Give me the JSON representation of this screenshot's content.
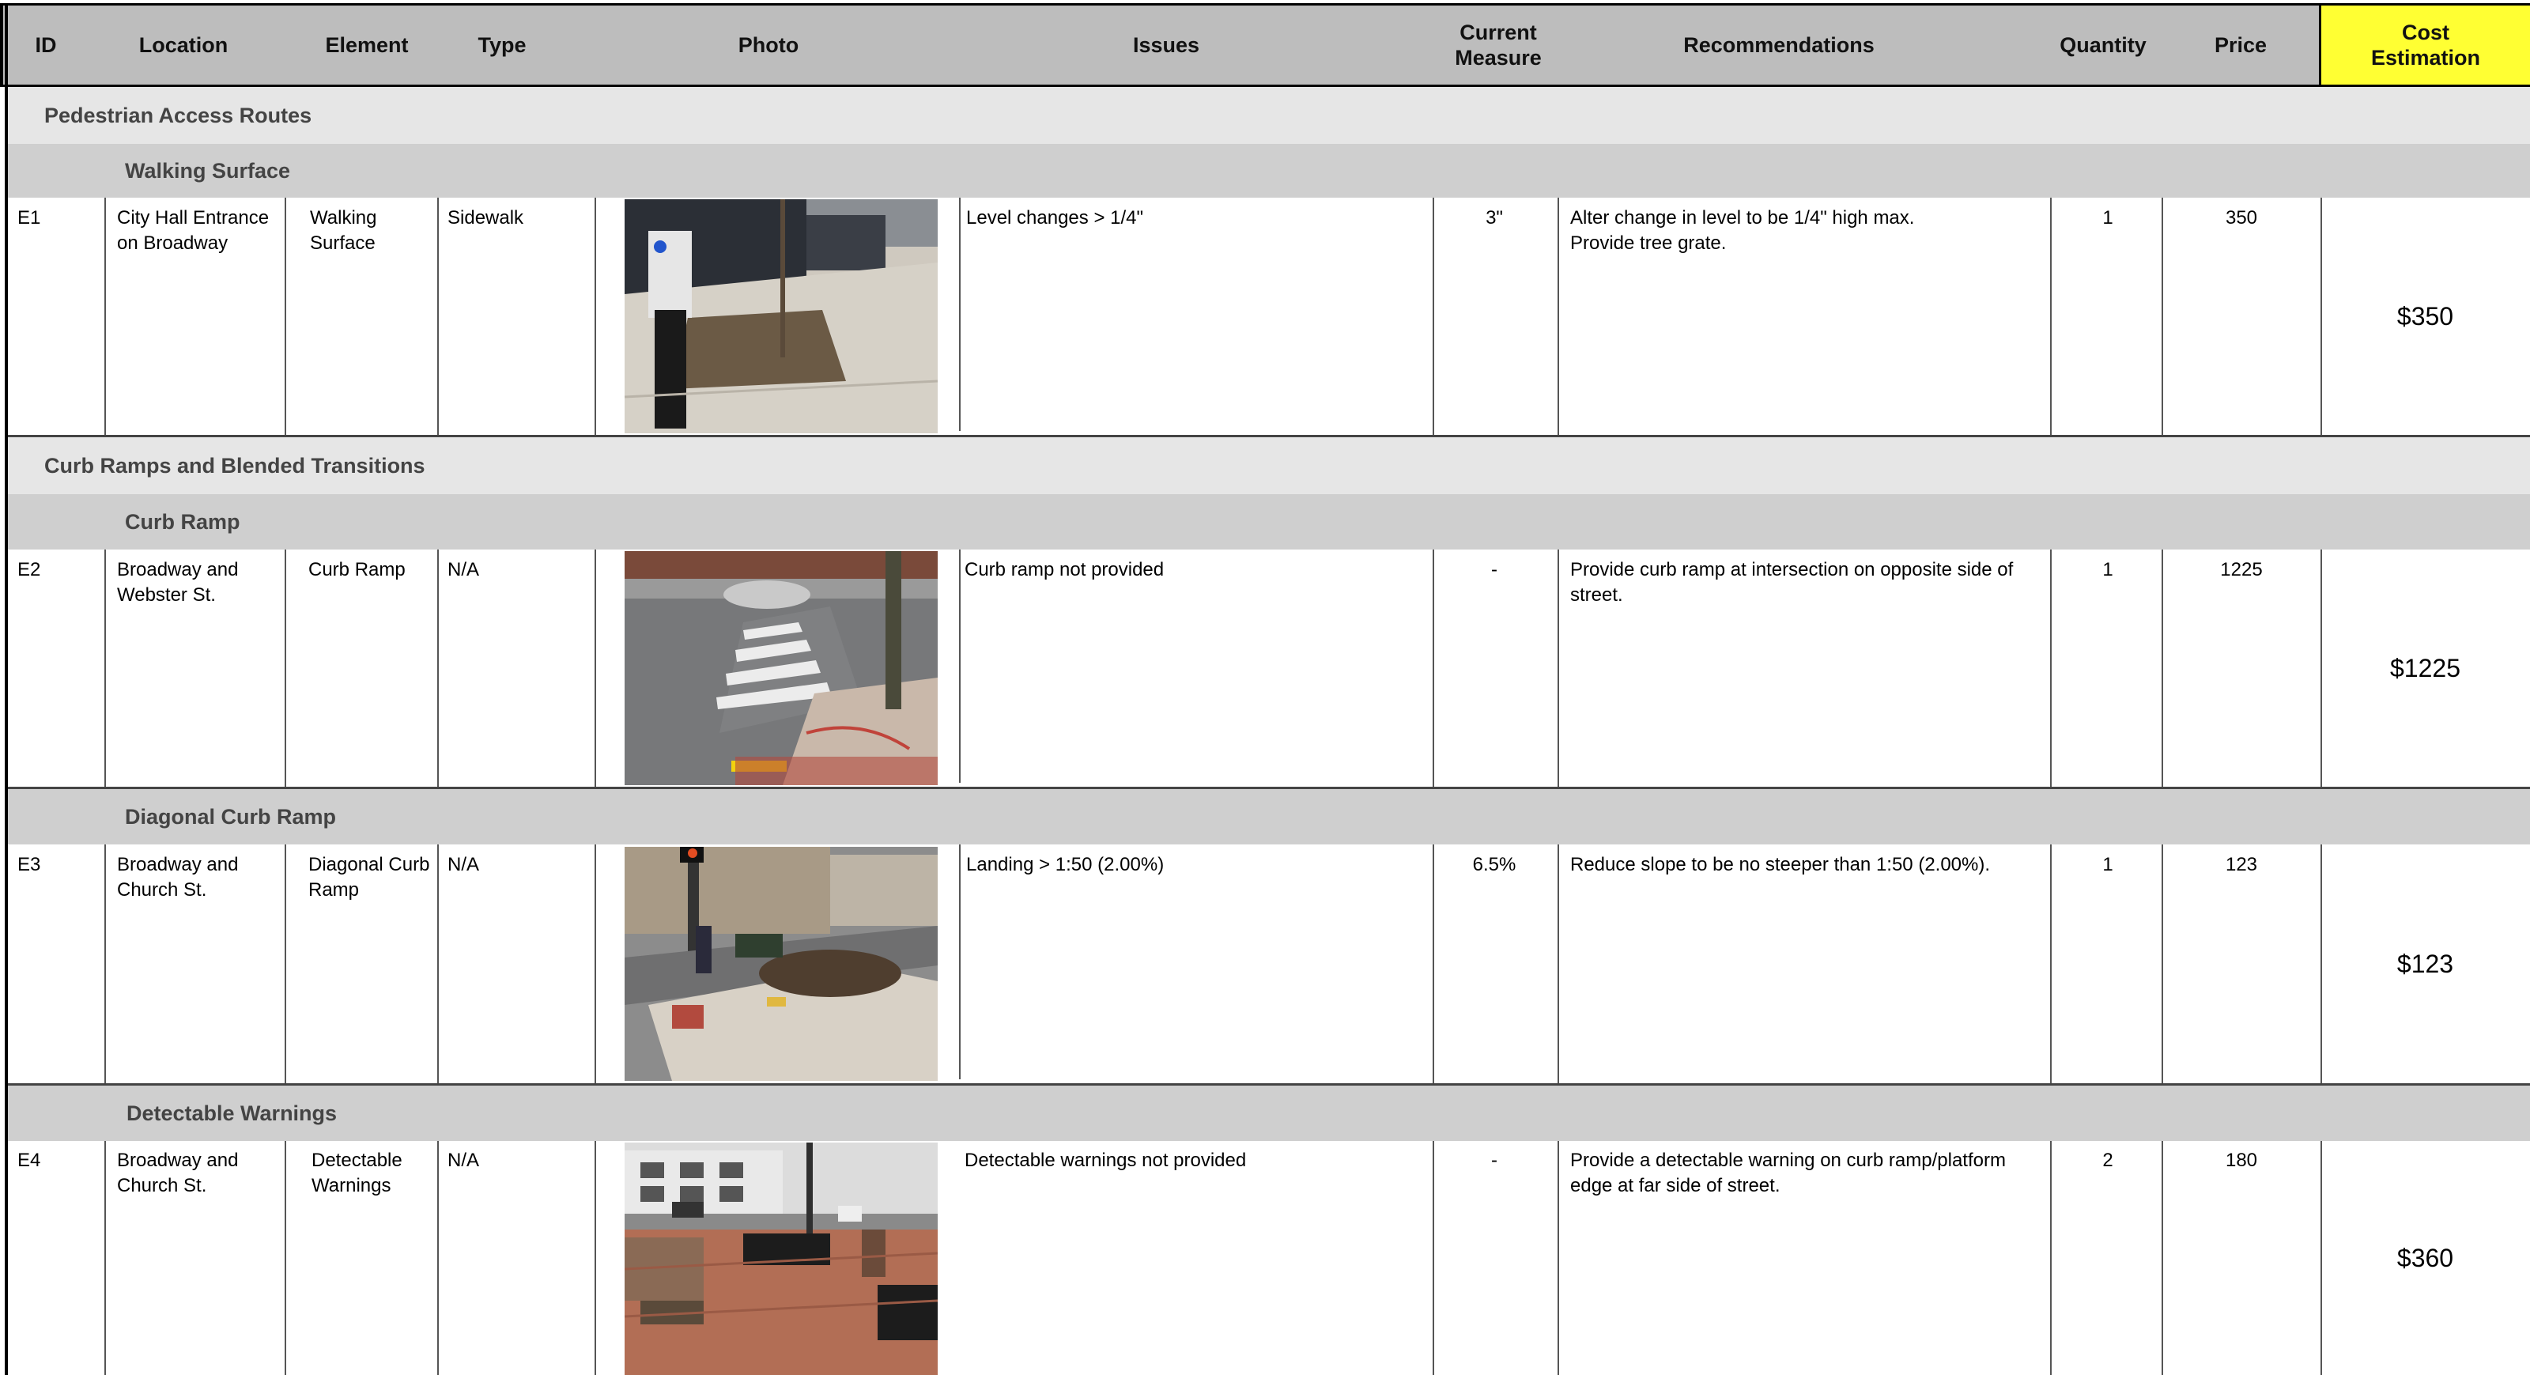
{
  "columns": {
    "id": "ID",
    "location": "Location",
    "element": "Element",
    "type": "Type",
    "photo": "Photo",
    "issues": "Issues",
    "current_measure": "Current\nMeasure",
    "recommendations": "Recommendations",
    "quantity": "Quantity",
    "price": "Price",
    "cost": "Cost\nEstimation"
  },
  "sections": {
    "par": "Pedestrian Access Routes",
    "crbt": "Curb Ramps and Blended Transitions"
  },
  "subsections": {
    "walking": "Walking Surface",
    "curb": "Curb Ramp",
    "diagonal": "Diagonal Curb Ramp",
    "detectable": "Detectable Warnings"
  },
  "rows": [
    {
      "id": "E1",
      "location": "City Hall Entrance\non Broadway",
      "element": "Walking\n Surface",
      "type": "Sidewalk",
      "photo_icon": "sidewalk-parking-meter-photo",
      "issues": "Level changes > 1/4\"",
      "current_measure": "3\"",
      "recommendations": "Alter change in level to be 1/4\" high max.\nProvide tree grate.",
      "quantity": "1",
      "price": "350",
      "cost": "$350"
    },
    {
      "id": "E2",
      "location": "Broadway and\nWebster St.",
      "element": "Curb Ramp",
      "type": "N/A",
      "photo_icon": "crosswalk-corner-photo",
      "issues": "Curb ramp not provided",
      "current_measure": "-",
      "recommendations": "Provide curb ramp at intersection on opposite side of\nstreet.",
      "quantity": "1",
      "price": "1225",
      "cost": "$1225"
    },
    {
      "id": "E3",
      "location": "Broadway and\nChurch St.",
      "element": "Diagonal Curb\n Ramp",
      "type": "N/A",
      "photo_icon": "diagonal-curb-ramp-photo",
      "issues": "Landing > 1:50 (2.00%)",
      "current_measure": "6.5%",
      "recommendations": "Reduce slope to be no steeper than 1:50 (2.00%).",
      "quantity": "1",
      "price": "123",
      "cost": "$123"
    },
    {
      "id": "E4",
      "location": "Broadway and\nChurch St.",
      "element": "Detectable\n Warnings",
      "type": "N/A",
      "photo_icon": "brick-plaza-bench-photo",
      "issues": "Detectable warnings not provided",
      "current_measure": "-",
      "recommendations": "Provide a detectable warning on curb ramp/platform\nedge at far side of street.",
      "quantity": "2",
      "price": "180",
      "cost": "$360"
    }
  ],
  "colors": {
    "header_bg": "#bdbdbd",
    "cost_header_bg": "#ffff33",
    "section_bg": "#e6e6e6",
    "subsection_bg": "#cfcfcf"
  }
}
